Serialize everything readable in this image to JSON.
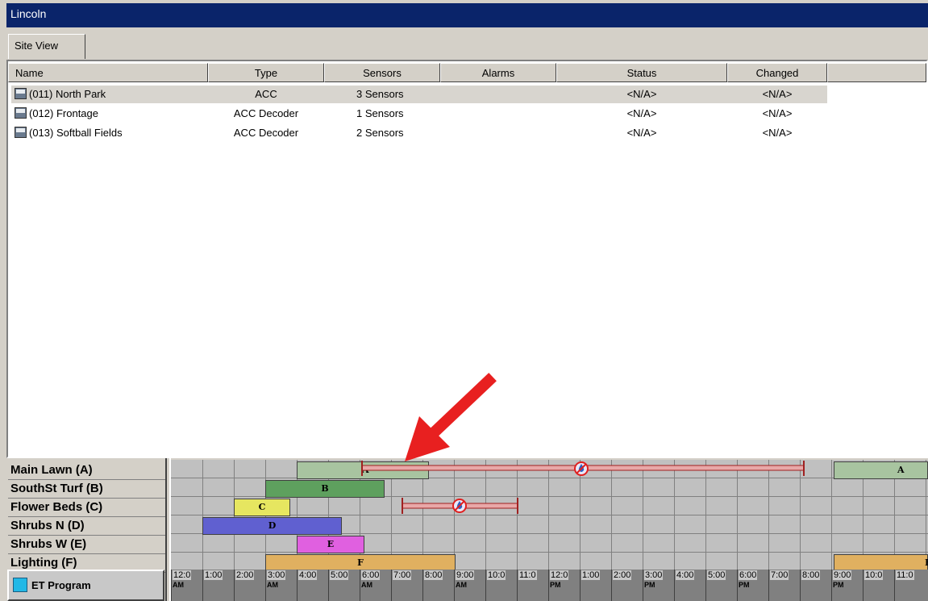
{
  "window": {
    "title": "Lincoln"
  },
  "tabs": [
    {
      "label": "Site View",
      "active": true
    }
  ],
  "table": {
    "columns": [
      "Name",
      "Type",
      "Sensors",
      "Alarms",
      "Status",
      "Changed"
    ],
    "rows": [
      {
        "name": "(011) North Park",
        "type": "ACC",
        "sensors": "3 Sensors",
        "alarms": "",
        "status": "<N/A>",
        "changed": "<N/A>",
        "selected": true
      },
      {
        "name": "(012) Frontage",
        "type": "ACC Decoder",
        "sensors": "1 Sensors",
        "alarms": "",
        "status": "<N/A>",
        "changed": "<N/A>",
        "selected": false
      },
      {
        "name": "(013) Softball Fields",
        "type": "ACC Decoder",
        "sensors": "2 Sensors",
        "alarms": "",
        "status": "<N/A>",
        "changed": "<N/A>",
        "selected": false
      }
    ]
  },
  "schedule": {
    "zones": [
      "Main Lawn (A)",
      "SouthSt Turf (B)",
      "Flower Beds (C)",
      "Shrubs N (D)",
      "Shrubs W (E)",
      "Lighting (F)"
    ],
    "et_program_label": "ET Program",
    "time_ticks": [
      "12:0",
      "1:00",
      "2:00",
      "3:00",
      "4:00",
      "5:00",
      "6:00",
      "7:00",
      "8:00",
      "9:00",
      "10:0",
      "11:0",
      "12:0",
      "1:00",
      "2:00",
      "3:00",
      "4:00",
      "5:00",
      "6:00",
      "7:00",
      "8:00",
      "9:00",
      "10:0",
      "11:0"
    ],
    "ampm_marks": [
      "AM",
      "AM",
      "AM",
      "AM",
      "PM",
      "PM",
      "PM",
      "PM"
    ],
    "bar_letters": [
      "A",
      "B",
      "C",
      "D",
      "E",
      "F",
      "A",
      "F"
    ],
    "colors": {
      "main_lawn": "#a8c4a0",
      "southst_turf": "#5ea05e",
      "flower_beds": "#e6e660",
      "shrubs_n": "#6060d0",
      "shrubs_w": "#e060e0",
      "lighting": "#e0b060",
      "interval": "#e8a8a8",
      "interval_border": "#a02020",
      "arrow": "#e82020"
    }
  }
}
